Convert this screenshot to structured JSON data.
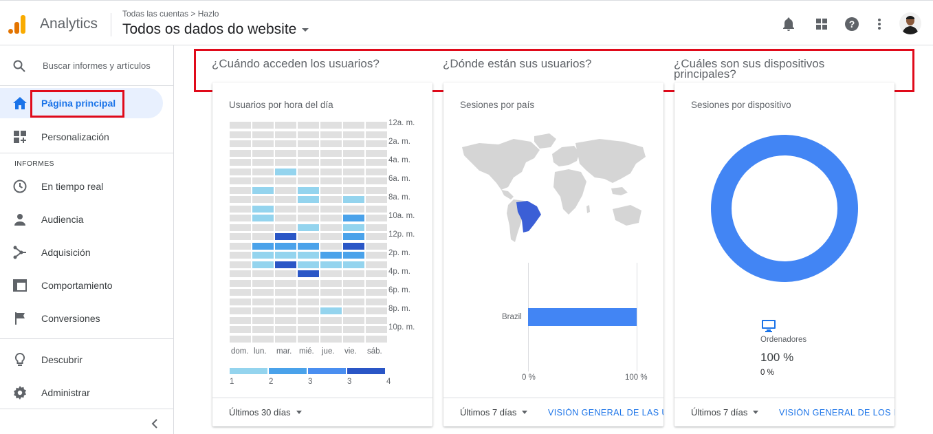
{
  "header": {
    "app_name": "Analytics",
    "breadcrumb": "Todas las cuentas > Hazlo",
    "property": "Todos os dados do website",
    "icons": [
      "bell-icon",
      "apps-icon",
      "help-icon",
      "more-icon"
    ]
  },
  "sidebar": {
    "search_placeholder": "Buscar informes y artículos",
    "home": "Página principal",
    "customization": "Personalización",
    "section": "INFORMES",
    "items": [
      {
        "label": "En tiempo real",
        "icon": "clock-icon"
      },
      {
        "label": "Audiencia",
        "icon": "person-icon"
      },
      {
        "label": "Adquisición",
        "icon": "acquisition-icon"
      },
      {
        "label": "Comportamiento",
        "icon": "behavior-icon"
      },
      {
        "label": "Conversiones",
        "icon": "flag-icon"
      }
    ],
    "discover": "Descubrir",
    "admin": "Administrar"
  },
  "questions": {
    "when": "¿Cuándo acceden los usuarios?",
    "where": "¿Dónde están sus usuarios?",
    "devices_line1": "¿Cuáles son sus dispositivos",
    "devices_line2": "principales?"
  },
  "cards": {
    "heatmap": {
      "title": "Usuarios por hora del día",
      "footer_range": "Últimos 30 días"
    },
    "country": {
      "title": "Sesiones por país",
      "footer_range": "Últimos 7 días",
      "footer_link": "VISIÓN GENERAL DE LAS UB",
      "axis_min": "0 %",
      "axis_max": "100 %"
    },
    "device": {
      "title": "Sesiones por dispositivo",
      "footer_range": "Últimos 7 días",
      "footer_link": "VISIÓN GENERAL DE LOS MÓ",
      "device_label": "Ordenadores",
      "device_pct": "100 %",
      "device_change": "0 %"
    }
  },
  "chart_data": [
    {
      "type": "heatmap",
      "title": "Usuarios por hora del día",
      "x": [
        "dom.",
        "lun.",
        "mar.",
        "mié.",
        "jue.",
        "vie.",
        "sáb."
      ],
      "y_labels": [
        "12a. m.",
        "2a. m.",
        "4a. m.",
        "6a. m.",
        "8a. m.",
        "10a. m.",
        "12p. m.",
        "2p. m.",
        "4p. m.",
        "6p. m.",
        "8p. m.",
        "10p. m."
      ],
      "legend": [
        "1",
        "2",
        "3",
        "3",
        "4"
      ],
      "colors": {
        "0": "#e0e0e0",
        "1": "#94d4ee",
        "2": "#4aa2ea",
        "3": "#4a8ef0",
        "4": "#2a56c6"
      },
      "values": [
        [
          0,
          0,
          0,
          0,
          0,
          0,
          0
        ],
        [
          0,
          0,
          0,
          0,
          0,
          0,
          0
        ],
        [
          0,
          0,
          0,
          0,
          0,
          0,
          0
        ],
        [
          0,
          0,
          0,
          0,
          0,
          0,
          0
        ],
        [
          0,
          0,
          0,
          0,
          0,
          0,
          0
        ],
        [
          0,
          0,
          1,
          0,
          0,
          0,
          0
        ],
        [
          0,
          0,
          0,
          0,
          0,
          0,
          0
        ],
        [
          0,
          1,
          0,
          1,
          0,
          0,
          0
        ],
        [
          0,
          0,
          0,
          1,
          0,
          1,
          0
        ],
        [
          0,
          1,
          0,
          0,
          0,
          0,
          0
        ],
        [
          0,
          1,
          0,
          0,
          0,
          2,
          0
        ],
        [
          0,
          0,
          0,
          1,
          0,
          1,
          0
        ],
        [
          0,
          0,
          4,
          0,
          0,
          2,
          0
        ],
        [
          0,
          2,
          2,
          2,
          0,
          4,
          0
        ],
        [
          0,
          1,
          1,
          1,
          2,
          2,
          0
        ],
        [
          0,
          1,
          4,
          1,
          1,
          1,
          0
        ],
        [
          0,
          0,
          0,
          4,
          0,
          0,
          0
        ],
        [
          0,
          0,
          0,
          0,
          0,
          0,
          0
        ],
        [
          0,
          0,
          0,
          0,
          0,
          0,
          0
        ],
        [
          0,
          0,
          0,
          0,
          0,
          0,
          0
        ],
        [
          0,
          0,
          0,
          0,
          1,
          0,
          0
        ],
        [
          0,
          0,
          0,
          0,
          0,
          0,
          0
        ],
        [
          0,
          0,
          0,
          0,
          0,
          0,
          0
        ],
        [
          0,
          0,
          0,
          0,
          0,
          0,
          0
        ]
      ]
    },
    {
      "type": "bar",
      "title": "Sesiones por país",
      "categories": [
        "Brazil"
      ],
      "values": [
        100
      ],
      "xlim": [
        0,
        100
      ],
      "highlight_color": "#3b5fd6"
    },
    {
      "type": "pie",
      "title": "Sesiones por dispositivo",
      "categories": [
        "Ordenadores"
      ],
      "values": [
        100
      ],
      "color": "#4285f4"
    }
  ]
}
